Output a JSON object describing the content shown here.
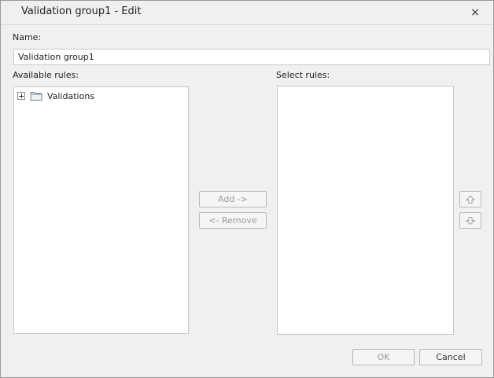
{
  "dialog": {
    "title": "Validation group1 - Edit",
    "close_glyph": "×"
  },
  "name": {
    "label": "Name:",
    "value": "Validation group1"
  },
  "available": {
    "label": "Available rules:",
    "tree": [
      {
        "label": "Validations",
        "expander": "plus",
        "icon": "folder-icon"
      }
    ]
  },
  "selected": {
    "label": "Select rules:",
    "items": []
  },
  "buttons": {
    "add": "Add ->",
    "remove": "<- Remove",
    "move_up_icon": "arrow-up-icon",
    "move_down_icon": "arrow-down-icon",
    "ok": "OK",
    "cancel": "Cancel"
  },
  "colors": {
    "dialog_bg": "#f0f0f0",
    "panel_bg": "#ffffff",
    "border": "#c8c8c8",
    "disabled_text": "#9a9a9a"
  }
}
